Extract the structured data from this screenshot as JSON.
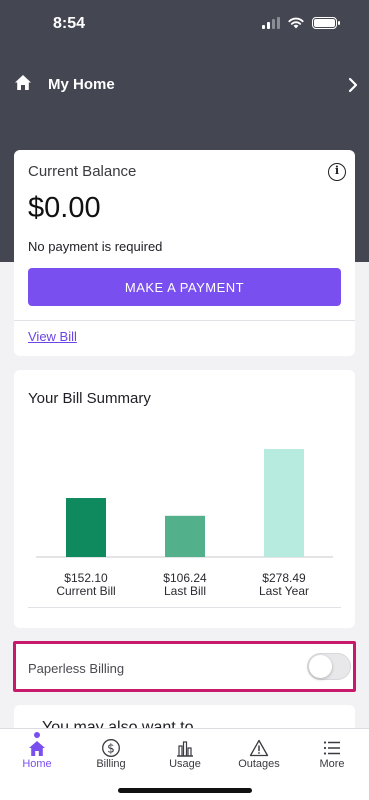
{
  "status_bar": {
    "time": "8:54"
  },
  "header": {
    "title": "My Home"
  },
  "balance": {
    "title": "Current Balance",
    "amount": "$0.00",
    "note": "No payment is required",
    "pay_button": "MAKE A PAYMENT",
    "view_bill": "View Bill"
  },
  "summary": {
    "title": "Your Bill Summary"
  },
  "chart_data": {
    "type": "bar",
    "categories": [
      "Current Bill",
      "Last Bill",
      "Last Year"
    ],
    "values": [
      152.1,
      106.24,
      278.49
    ],
    "value_labels": [
      "$152.10",
      "$106.24",
      "$278.49"
    ],
    "colors": [
      "#0f8a5f",
      "#52b08a",
      "#b7ebe0"
    ],
    "ylim": [
      0,
      278.49
    ]
  },
  "paperless": {
    "label": "Paperless Billing",
    "enabled": false
  },
  "also": {
    "text": "You may also want to"
  },
  "tabs": [
    {
      "label": "Home",
      "icon": "home-icon",
      "active": true
    },
    {
      "label": "Billing",
      "icon": "dollar-circle-icon",
      "active": false
    },
    {
      "label": "Usage",
      "icon": "bar-chart-icon",
      "active": false
    },
    {
      "label": "Outages",
      "icon": "warning-icon",
      "active": false
    },
    {
      "label": "More",
      "icon": "menu-list-icon",
      "active": false
    }
  ],
  "colors": {
    "accent": "#7a4ff0",
    "header": "#444752",
    "highlight": "#c81a6d"
  }
}
